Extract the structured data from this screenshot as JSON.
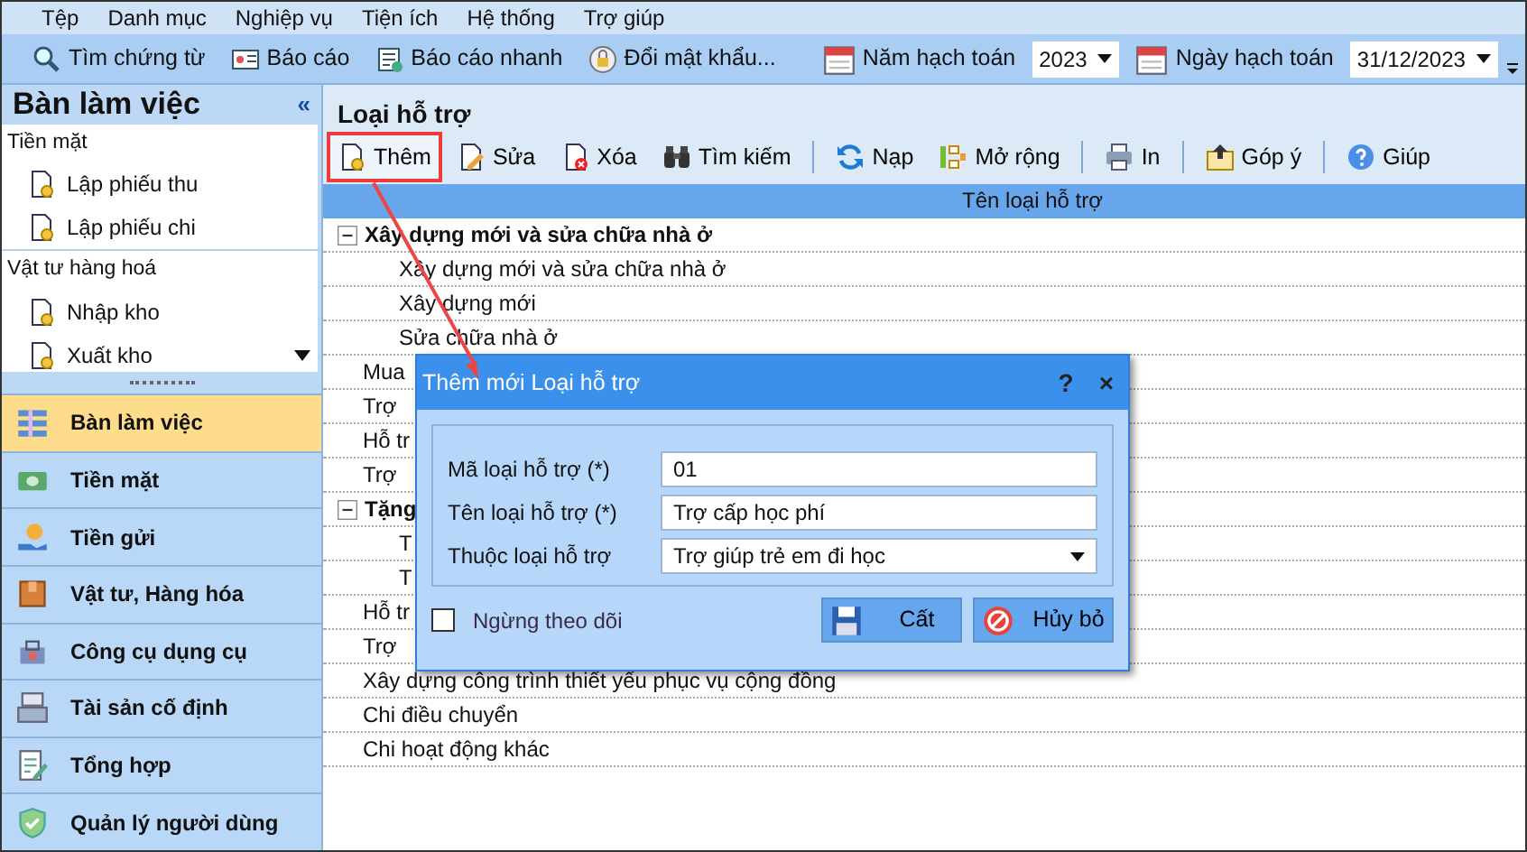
{
  "menu": [
    {
      "label": "Tệp"
    },
    {
      "label": "Danh mục"
    },
    {
      "label": "Nghiệp vụ"
    },
    {
      "label": "Tiện ích"
    },
    {
      "label": "Hệ thống"
    },
    {
      "label": "Trợ giúp"
    }
  ],
  "toolbar": {
    "items": [
      {
        "label": "Tìm chứng từ",
        "kind": "search"
      },
      {
        "label": "Báo cáo",
        "kind": "report"
      },
      {
        "label": "Báo cáo nhanh",
        "kind": "quick"
      },
      {
        "label": "Đổi mật khẩu...",
        "kind": "key"
      }
    ],
    "year": {
      "label": "Năm hạch toán",
      "value": "2023"
    },
    "date": {
      "label": "Ngày hạch toán",
      "value": "31/12/2023"
    }
  },
  "sidebar": {
    "title": "Bàn làm việc",
    "collapse": "«",
    "groups": [
      {
        "label": "Tiền mặt",
        "items": [
          {
            "label": "Lập phiếu thu"
          },
          {
            "label": "Lập phiếu chi"
          }
        ]
      },
      {
        "label": "Vật tư hàng hoá",
        "items": [
          {
            "label": "Nhập kho"
          },
          {
            "label": "Xuất kho"
          }
        ]
      }
    ],
    "modules": [
      {
        "label": "Bàn làm việc",
        "kind": "desk",
        "selected": true
      },
      {
        "label": "Tiền mặt",
        "kind": "cash",
        "selected": false
      },
      {
        "label": "Tiền gửi",
        "kind": "deposit",
        "selected": false
      },
      {
        "label": "Vật tư, Hàng hóa",
        "kind": "box",
        "selected": false
      },
      {
        "label": "Công cụ dụng cụ",
        "kind": "tools",
        "selected": false
      },
      {
        "label": "Tài sản cố định",
        "kind": "asset",
        "selected": false
      },
      {
        "label": "Tổng hợp",
        "kind": "summary",
        "selected": false
      },
      {
        "label": "Quản lý người dùng",
        "kind": "user",
        "selected": false
      }
    ]
  },
  "main": {
    "title": "Loại hỗ trợ",
    "toolbar": [
      {
        "label": "Thêm",
        "kind": "add",
        "highlighted": true
      },
      {
        "label": "Sửa",
        "kind": "edit",
        "highlighted": false
      },
      {
        "label": "Xóa",
        "kind": "delete",
        "highlighted": false
      },
      {
        "label": "Tìm kiếm",
        "kind": "find",
        "highlighted": false
      },
      {
        "label": "Nạp",
        "kind": "reload",
        "highlighted": false
      },
      {
        "label": "Mở rộng",
        "kind": "expand",
        "highlighted": false
      },
      {
        "label": "In",
        "kind": "print",
        "highlighted": false
      },
      {
        "label": "Góp ý",
        "kind": "feedback",
        "highlighted": false
      },
      {
        "label": "Giúp",
        "kind": "help",
        "highlighted": false
      }
    ],
    "column": "Tên loại hỗ trợ",
    "rows": [
      {
        "label": "Xây dựng mới và sửa chữa nhà ở",
        "expanded": true,
        "children": [
          {
            "label": "Xây dựng mới và sửa chữa nhà ở"
          },
          {
            "label": "Xây dựng mới"
          },
          {
            "label": "Sửa chữa nhà ở"
          }
        ]
      },
      {
        "label": "Mua"
      },
      {
        "label": "Trợ"
      },
      {
        "label": "Hỗ tr"
      },
      {
        "label": "Trợ"
      },
      {
        "label": "Tặng",
        "expanded": true,
        "children": [
          {
            "label": "T"
          },
          {
            "label": "T"
          }
        ]
      },
      {
        "label": "Hỗ tr"
      },
      {
        "label": "Trợ"
      },
      {
        "label": "Xây dựng công trình thiết yếu phục vụ cộng đồng"
      },
      {
        "label": "Chi điều chuyển"
      },
      {
        "label": "Chi hoạt động khác"
      }
    ]
  },
  "dialog": {
    "title": "Thêm mới Loại hỗ trợ",
    "help": "?",
    "close": "×",
    "fields": [
      {
        "label": "Mã loại hỗ trợ (*)",
        "value": "01",
        "kind": "text"
      },
      {
        "label": "Tên loại hỗ trợ (*)",
        "value": "Trợ cấp học phí",
        "kind": "text"
      },
      {
        "label": "Thuộc loại hỗ trợ",
        "value": "Trợ giúp trẻ em đi học",
        "kind": "select"
      }
    ],
    "checkbox": {
      "label": "Ngừng theo dõi",
      "checked": false
    },
    "buttons": [
      {
        "label": "Cất",
        "kind": "save"
      },
      {
        "label": "Hủy bỏ",
        "kind": "cancel"
      }
    ]
  }
}
